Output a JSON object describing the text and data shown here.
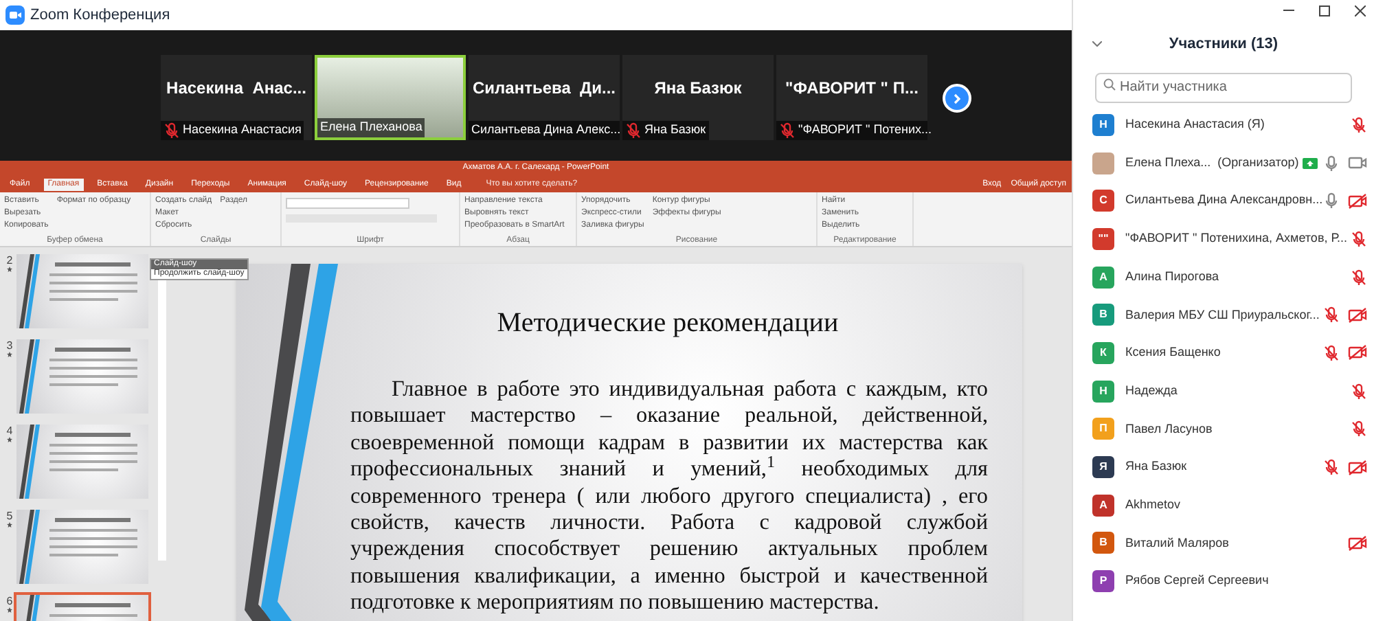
{
  "window": {
    "title": "Zoom Конференция"
  },
  "video_strip": {
    "tiles": [
      {
        "kind": "name",
        "big_name": "Насекина  Анас...",
        "label": "Насекина Анастасия",
        "muted": true,
        "active_speaker": false
      },
      {
        "kind": "video",
        "label": "Елена Плеханова",
        "muted": false,
        "active_speaker": true
      },
      {
        "kind": "name",
        "big_name": "Силантьева  Ди...",
        "label": "Силантьева Дина Алекс...",
        "muted": false,
        "active_speaker": false
      },
      {
        "kind": "name",
        "big_name": "Яна Базюк",
        "label": "Яна Базюк",
        "muted": true,
        "active_speaker": false
      },
      {
        "kind": "name",
        "big_name": "\"ФАВОРИТ \" П...",
        "label": "\"ФАВОРИТ \" Потених...",
        "muted": true,
        "active_speaker": false
      }
    ]
  },
  "powerpoint": {
    "title": "Ахматов А.А. г. Салехард - PowerPoint",
    "tabs": [
      {
        "label": "Файл",
        "selected": false
      },
      {
        "label": "Главная",
        "selected": true
      },
      {
        "label": "Вставка",
        "selected": false
      },
      {
        "label": "Дизайн",
        "selected": false
      },
      {
        "label": "Переходы",
        "selected": false
      },
      {
        "label": "Анимация",
        "selected": false
      },
      {
        "label": "Слайд-шоу",
        "selected": false
      },
      {
        "label": "Рецензирование",
        "selected": false
      },
      {
        "label": "Вид",
        "selected": false
      }
    ],
    "search_hint": "Что вы хотите сделать?",
    "sign_in": "Вход",
    "share": "Общий доступ",
    "ribbon_groups": [
      {
        "label": "Буфер обмена",
        "buttons": [
          "Вставить",
          "Вырезать",
          "Копировать",
          "Формат по образцу"
        ]
      },
      {
        "label": "Слайды",
        "buttons": [
          "Создать слайд",
          "Макет",
          "Сбросить",
          "Раздел"
        ]
      },
      {
        "label": "Шрифт"
      },
      {
        "label": "Абзац",
        "buttons": [
          "Направление текста",
          "Выровнять текст",
          "Преобразовать в SmartArt"
        ]
      },
      {
        "label": "Рисование",
        "buttons": [
          "Упорядочить",
          "Экспресс-стили",
          "Заливка фигуры",
          "Контур фигуры",
          "Эффекты фигуры"
        ]
      },
      {
        "label": "Редактирование",
        "buttons": [
          "Найти",
          "Заменить",
          "Выделить"
        ]
      }
    ],
    "tooltip": {
      "title": "Слайд-шоу",
      "item": "Продолжить слайд-шоу"
    },
    "thumbnails": [
      {
        "number": "2",
        "selected": false
      },
      {
        "number": "3",
        "selected": false
      },
      {
        "number": "4",
        "selected": false
      },
      {
        "number": "5",
        "selected": false
      },
      {
        "number": "6",
        "selected": true
      }
    ],
    "slide": {
      "title": "Методические рекомендации",
      "body": "Главное в работе  это индивидуальная работа  с  каждым, кто повышает мастерство – оказание реальной, действенной, своевременной помощи кадрам в развитии их мастерства как профессиональных  знаний  и  умений,$^{1}$ необходимых  для современного тренера ( или любого другого специалиста) , его свойств,  качеств  личности.  Работа  с  кадровой  службой учреждения  способствует  решению  актуальных  проблем повышения квалификации, а именно быстрой и качественной подготовке к мероприятиям по повышению мастерства."
    }
  },
  "participants": {
    "title": "Участники (13)",
    "search": {
      "placeholder": "Найти участника"
    },
    "items": [
      {
        "name": "Насекина Анастасия (Я)",
        "avatar": "Н",
        "kind": "letter",
        "color": "#1e7fd0",
        "mic_muted": true,
        "sharing": false
      },
      {
        "name": "Елена Плеха...  (Организатор)",
        "kind": "photo",
        "color": "#c9a58c",
        "mic_muted": false,
        "video_off": false,
        "sharing": true
      },
      {
        "name": "Силантьева Дина Александровн...",
        "avatar": "С",
        "kind": "letter",
        "color": "#d23a2c",
        "mic_muted": false,
        "video_off": true,
        "sharing": false
      },
      {
        "name": "\"ФАВОРИТ \" Потенихина, Ахметов, Р...",
        "avatar": "\"\"",
        "kind": "letter",
        "color": "#d23a2c",
        "mic_muted": true,
        "sharing": false
      },
      {
        "name": "Алина Пирогова",
        "avatar": "А",
        "kind": "letter",
        "color": "#27a55d",
        "mic_muted": true,
        "sharing": false
      },
      {
        "name": "Валерия МБУ СШ Приуральског...",
        "avatar": "В",
        "kind": "letter",
        "color": "#179b7c",
        "mic_muted": true,
        "video_off": true,
        "sharing": false
      },
      {
        "name": "Ксения Бащенко",
        "avatar": "К",
        "kind": "letter",
        "color": "#27a55d",
        "mic_muted": true,
        "video_off": true,
        "sharing": false
      },
      {
        "name": "Надежда",
        "avatar": "Н",
        "kind": "letter",
        "color": "#27a55d",
        "mic_muted": true,
        "sharing": false
      },
      {
        "name": "Павел Ласунов",
        "avatar": "П",
        "kind": "letter",
        "color": "#f2a01c",
        "mic_muted": true,
        "sharing": false
      },
      {
        "name": "Яна Базюк",
        "avatar": "Я",
        "kind": "letter",
        "color": "#2c3a52",
        "mic_muted": true,
        "video_off": true,
        "sharing": false
      },
      {
        "name": "Akhmetov",
        "avatar": "A",
        "kind": "letter",
        "color": "#c0322a",
        "sharing": false
      },
      {
        "name": "Виталий Маляров",
        "avatar": "В",
        "kind": "letter",
        "color": "#d2570e",
        "video_off": true,
        "sharing": false
      },
      {
        "name": "Рябов Сергей Сергеевич",
        "avatar": "Р",
        "kind": "letter",
        "color": "#8e3fb0",
        "sharing": false
      }
    ]
  }
}
